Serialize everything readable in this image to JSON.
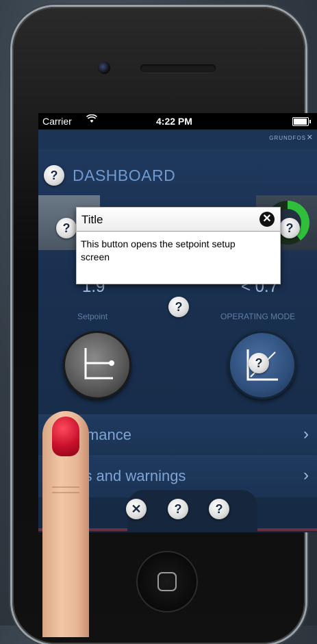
{
  "status_bar": {
    "carrier": "Carrier",
    "wifi_icon": "wifi-icon",
    "time": "4:22 PM",
    "battery_icon": "battery-icon"
  },
  "brand": {
    "text": "GRUNDFOS",
    "icon": "grundfos-x-icon"
  },
  "dashboard": {
    "title": "DASHBOARD",
    "help_symbol": "?",
    "left_value": "1.9",
    "right_value": "< 0.7",
    "setpoint_label": "Setpoint",
    "operating_mode_label": "OPERATING MODE"
  },
  "tooltip": {
    "title": "Title",
    "close_symbol": "✕",
    "body": "This button opens the setpoint setup screen"
  },
  "menu": {
    "items": [
      {
        "label": "Performance",
        "chevron": "›"
      },
      {
        "label": "Alarms and warnings",
        "chevron": "›"
      }
    ]
  },
  "bottom_controls": {
    "close_symbol": "✕",
    "help_symbol": "?"
  },
  "colors": {
    "screen_bg": "#1f3a5f",
    "accent_text": "#6f9ad0",
    "gauge_green": "#2fbf3a",
    "nail_red": "#c8102b"
  }
}
